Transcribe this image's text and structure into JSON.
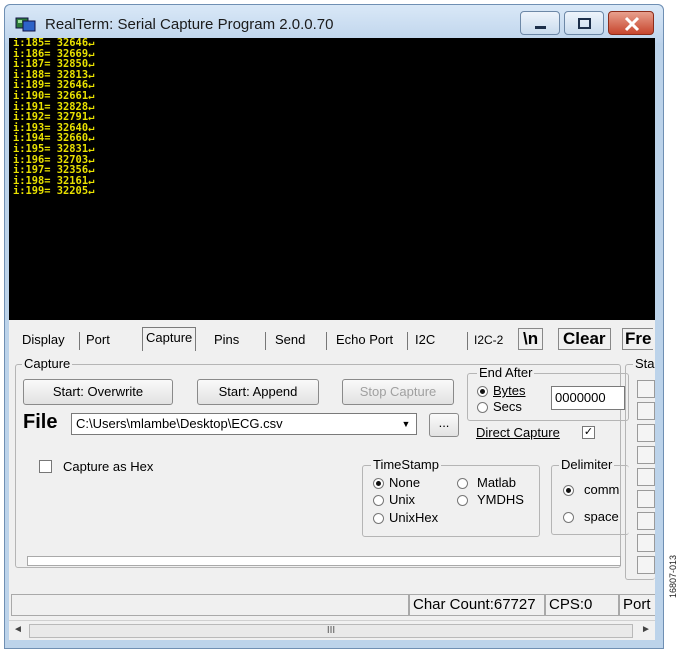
{
  "window": {
    "title": "RealTerm: Serial Capture Program 2.0.0.70"
  },
  "terminal": {
    "lines": [
      "i:185= 32646↵",
      "i:186= 32669↵",
      "i:187= 32850↵",
      "i:188= 32813↵",
      "i:189= 32646↵",
      "i:190= 32661↵",
      "i:191= 32828↵",
      "i:192= 32791↵",
      "i:193= 32640↵",
      "i:194= 32660↵",
      "i:195= 32831↵",
      "i:196= 32703↵",
      "i:197= 32356↵",
      "i:198= 32161↵",
      "i:199= 32205↵"
    ],
    "text_color": "#e8e000",
    "background": "#000000"
  },
  "tabs": {
    "display": "Display",
    "port": "Port",
    "capture": "Capture",
    "pins": "Pins",
    "send": "Send",
    "echo_port": "Echo Port",
    "i2c": "I2C",
    "i2c2": "I2C-2",
    "newline": "\\n",
    "clear": "Clear",
    "freeze": "Fre"
  },
  "capture": {
    "group_label": "Capture",
    "start_overwrite": "Start: Overwrite",
    "start_append": "Start: Append",
    "stop_capture": "Stop Capture",
    "file_label": "File",
    "file_path": "C:\\Users\\mlambe\\Desktop\\ECG.csv",
    "browse": "...",
    "capture_as_hex": "Capture as Hex",
    "capture_as_hex_checked": false
  },
  "end_after": {
    "label": "End After",
    "bytes": "Bytes",
    "secs": "Secs",
    "selected": "Bytes",
    "value": "0000000"
  },
  "direct_capture": {
    "label": "Direct Capture",
    "checked": true
  },
  "timestamp": {
    "label": "TimeStamp",
    "options": [
      "None",
      "Matlab",
      "Unix",
      "YMDHS",
      "UnixHex"
    ],
    "selected": "None"
  },
  "delimiter": {
    "label": "Delimiter",
    "options": [
      "comm",
      "space"
    ],
    "selected": "comm"
  },
  "status_group": {
    "label": "Sta"
  },
  "statusbar": {
    "char_count": "Char Count:67727",
    "cps": "CPS:0",
    "port": "Port"
  },
  "scrollbar": {
    "left_arrow": "◄",
    "right_arrow": "►",
    "grip": "III"
  },
  "figure_code": "16807-013"
}
